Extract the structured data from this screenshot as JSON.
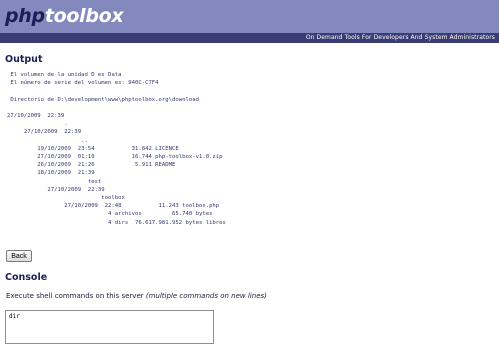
{
  "header": {
    "logo_prefix": "php",
    "logo_suffix": "toolbox",
    "tagline": "On Demand Tools For Developers And System Administrators"
  },
  "output": {
    "heading": "Output",
    "text": " El volumen de la unidad D es Data\n El número de serie del volumen es: 940C-C7F4\n\n Directorio de D:\\development\\www\\phptoolbox.org\\download\n\n27/10/2009  22:39\n                 .\n     27/10/2009  22:39\n                      ..\n         19/10/2009  23:54           31.842 LICENCE\n         27/10/2009  01:10           16.744 php-toolbox-v1.0.zip\n         26/10/2009  21:26            5.911 README\n         18/10/2009  21:39\n                        test\n            27/10/2009  22:39\n                            toolbox\n                 27/10/2009  22:48           11.243 toolbox.php\n                              4 archivos         65.740 bytes\n                              4 dirs  76.617.981.952 bytes libres",
    "back_label": "Back"
  },
  "console": {
    "heading": "Console",
    "description": "Execute shell commands on this server ",
    "description_note": "(multiple commands on new lines)",
    "command_value": "dir"
  }
}
